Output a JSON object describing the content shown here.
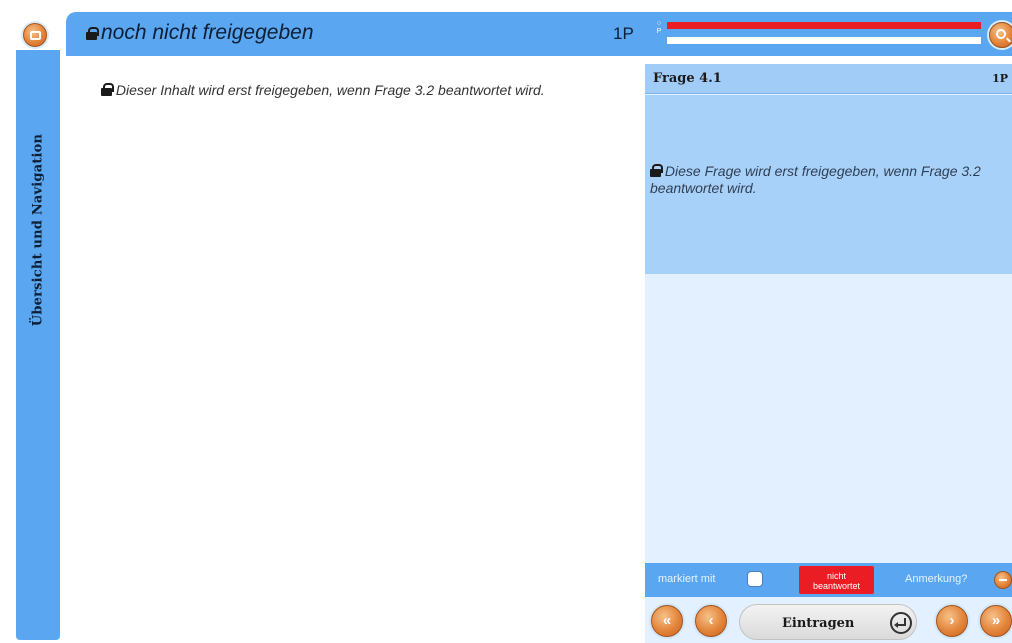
{
  "sidebar": {
    "nav_label": "Übersicht und Navigation",
    "home_icon": "home-icon"
  },
  "header": {
    "title": "noch nicht freigegeben",
    "points": "1P",
    "legend_marks": [
      "○",
      "P"
    ],
    "progress": [
      {
        "fraction": 1.0,
        "color": "#ea1c24"
      },
      {
        "fraction": 0.0,
        "color": "#ea1c24"
      }
    ],
    "search_icon": "magnifier-icon"
  },
  "content": {
    "notice": "Dieser Inhalt wird erst freigegeben, wenn Frage 3.2 beantwortet wird."
  },
  "question": {
    "title": "Frage 4.1",
    "points": "1P",
    "notice": "Diese Frage wird erst freigegeben, wenn Frage 3.2 beantwortet wird."
  },
  "status": {
    "marked_label": "markiert mit",
    "badge_line1": "nicht",
    "badge_line2": "beantwortet",
    "note_label": "Anmerkung?"
  },
  "nav": {
    "first": "«",
    "prev": "‹",
    "submit_label": "Eintragen",
    "next": "›",
    "last": "»"
  },
  "colors": {
    "accent_blue": "#5aa6f0",
    "panel_blue": "#a8d1fa",
    "alert_red": "#ea1c24",
    "orb_orange": "#e3843a"
  }
}
